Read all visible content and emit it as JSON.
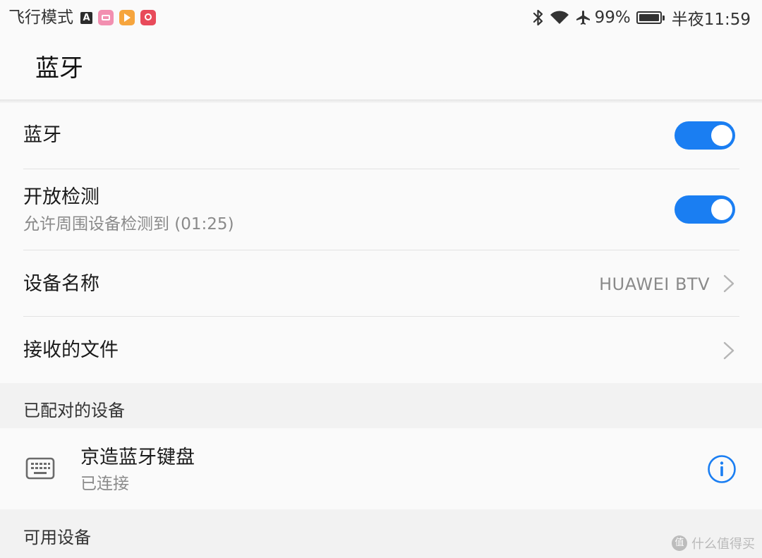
{
  "status_bar": {
    "left_text": "飞行模式",
    "battery_percent": "99%",
    "time": "半夜11:59",
    "icons": [
      "bluetooth-icon",
      "wifi-icon",
      "airplane-icon",
      "battery-icon"
    ]
  },
  "header": {
    "title": "蓝牙"
  },
  "settings": {
    "bluetooth": {
      "label": "蓝牙",
      "enabled": true
    },
    "discovery": {
      "label": "开放检测",
      "subtitle": "允许周围设备检测到 (01:25)",
      "enabled": true
    },
    "device_name": {
      "label": "设备名称",
      "value": "HUAWEI BTV"
    },
    "received_files": {
      "label": "接收的文件"
    }
  },
  "paired": {
    "section_title": "已配对的设备",
    "devices": [
      {
        "name": "京造蓝牙键盘",
        "status": "已连接",
        "icon": "keyboard-icon"
      }
    ]
  },
  "available": {
    "section_title": "可用设备"
  },
  "watermark": {
    "badge": "值",
    "text": "什么值得买"
  },
  "colors": {
    "accent": "#1a7ef2",
    "text_primary": "#1a1a1a",
    "text_secondary": "#8a8a8a",
    "background": "#fafafa",
    "section_background": "#f2f2f2"
  }
}
